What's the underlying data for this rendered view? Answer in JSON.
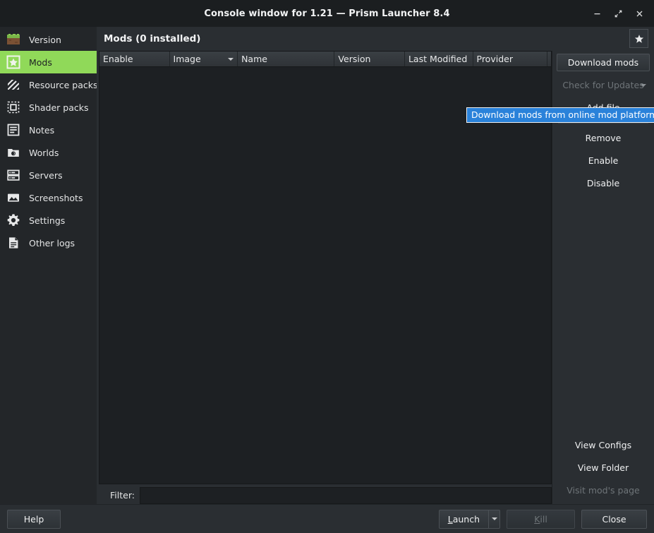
{
  "window": {
    "title": "Console window for 1.21 — Prism Launcher 8.4",
    "minimize_label": "Minimize",
    "maximize_label": "Maximize",
    "close_label": "Close"
  },
  "sidebar": {
    "items": [
      {
        "label": "Version",
        "icon": "grass-block-icon",
        "selected": false
      },
      {
        "label": "Mods",
        "icon": "star-box-icon",
        "selected": true
      },
      {
        "label": "Resource packs",
        "icon": "hatched-box-icon",
        "selected": false
      },
      {
        "label": "Shader packs",
        "icon": "dashed-box-icon",
        "selected": false
      },
      {
        "label": "Notes",
        "icon": "lines-doc-icon",
        "selected": false
      },
      {
        "label": "Worlds",
        "icon": "folder-globe-icon",
        "selected": false
      },
      {
        "label": "Servers",
        "icon": "server-rack-icon",
        "selected": false
      },
      {
        "label": "Screenshots",
        "icon": "image-icon",
        "selected": false
      },
      {
        "label": "Settings",
        "icon": "gear-icon",
        "selected": false
      },
      {
        "label": "Other logs",
        "icon": "file-text-icon",
        "selected": false
      }
    ]
  },
  "content": {
    "page_title": "Mods (0 installed)",
    "favorite_button_label": "Favorite",
    "table": {
      "columns": [
        {
          "label": "Enable",
          "width": 100,
          "sorted": false
        },
        {
          "label": "Image",
          "width": 97,
          "sorted": true
        },
        {
          "label": "Name",
          "width": 138,
          "sorted": false
        },
        {
          "label": "Version",
          "width": 100,
          "sorted": false
        },
        {
          "label": "Last Modified",
          "width": 97,
          "sorted": false
        },
        {
          "label": "Provider",
          "width": 106,
          "sorted": false
        }
      ],
      "rows": []
    },
    "filter": {
      "label": "Filter:",
      "value": "",
      "placeholder": ""
    }
  },
  "actions": {
    "top": [
      {
        "label": "Download mods",
        "style": "framed",
        "disabled": false,
        "menu": false
      },
      {
        "label": "Check for Updates",
        "style": "flat",
        "disabled": true,
        "menu": true
      },
      {
        "label": "Add file",
        "style": "flat",
        "disabled": false,
        "menu": false
      }
    ],
    "middle": [
      {
        "label": "Remove",
        "style": "flat",
        "disabled": false,
        "menu": false
      },
      {
        "label": "Enable",
        "style": "flat",
        "disabled": false,
        "menu": false
      },
      {
        "label": "Disable",
        "style": "flat",
        "disabled": false,
        "menu": false
      }
    ],
    "bottom": [
      {
        "label": "View Configs",
        "style": "flat",
        "disabled": false,
        "menu": false
      },
      {
        "label": "View Folder",
        "style": "flat",
        "disabled": false,
        "menu": false
      },
      {
        "label": "Visit mod's page",
        "style": "flat",
        "disabled": true,
        "menu": false
      }
    ]
  },
  "tooltip": {
    "text": "Download mods from online mod platforms"
  },
  "bottom_bar": {
    "help_label": "Help",
    "launch_label": "Launch",
    "launch_mnemonic": "L",
    "launch_menu_label": "Launch options",
    "kill_label": "Kill",
    "kill_mnemonic": "K",
    "kill_disabled": true,
    "close_label": "Close"
  },
  "colors": {
    "accent_green": "#90d959",
    "tooltip_blue": "#2a82da",
    "window_bg": "#2a2e32",
    "sidebar_bg": "#232629",
    "table_bg": "#1d2023",
    "titlebar_bg": "#1b1e20"
  }
}
